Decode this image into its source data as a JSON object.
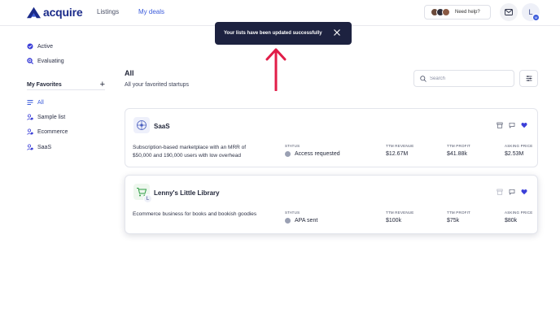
{
  "nav": {
    "brand": "acquire",
    "links": [
      "Listings",
      "My deals"
    ],
    "help_label": "Need help?",
    "user_initial": "L",
    "user_badge": "M"
  },
  "toast": {
    "message": "Your lists have been updated successfully"
  },
  "sidebar": {
    "status_items": [
      {
        "label": "Active"
      },
      {
        "label": "Evaluating"
      }
    ],
    "favorites_title": "My Favorites",
    "favorites": [
      {
        "label": "All",
        "active": true
      },
      {
        "label": "Sample list"
      },
      {
        "label": "Ecommerce"
      },
      {
        "label": "SaaS"
      }
    ]
  },
  "main": {
    "title": "All",
    "subtitle": "All your favorited startups",
    "search_placeholder": "Search"
  },
  "columns": {
    "status": "STATUS",
    "revenue": "TTM REVENUE",
    "profit": "TTM PROFIT",
    "price": "ASKING PRICE"
  },
  "cards": [
    {
      "name": "SaaS",
      "description": "Subscription-based marketplace with an MRR of $50,000 and 190,000 users with low overhead",
      "status": "Access requested",
      "revenue": "$12.67M",
      "profit": "$41.88k",
      "price": "$2.53M"
    },
    {
      "name": "Lenny's Little Library",
      "description": "Ecommerce business for books and bookish goodies",
      "status": "APA sent",
      "revenue": "$100k",
      "profit": "$75k",
      "price": "$80k",
      "logo_initial": "L"
    }
  ],
  "colors": {
    "accent": "#3b5bdb",
    "brand": "#1b2b8a",
    "toast_bg": "#1d2240",
    "arrow": "#e11d48",
    "heart": "#3b3fd8"
  }
}
